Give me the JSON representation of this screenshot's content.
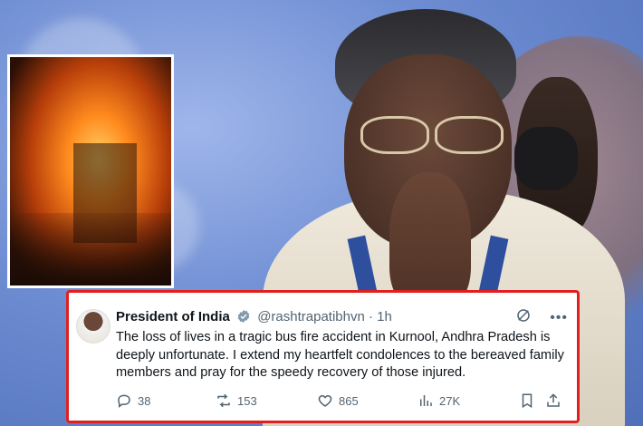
{
  "scene": {
    "inset_photo": "bus-fire-photo",
    "main_photo": "president-namaste-photo"
  },
  "tweet": {
    "author_name": "President of India",
    "handle_time": "@rashtrapatibhvn · 1h",
    "text": "The loss of lives in a tragic bus fire accident in Kurnool, Andhra Pradesh is deeply unfortunate. I extend my heartfelt condolences to the bereaved family members and pray for the speedy recovery of those injured.",
    "actions": {
      "replies": "38",
      "retweets": "153",
      "likes": "865",
      "views": "27K"
    },
    "colors": {
      "border": "#e02020",
      "verified": "#829aab",
      "text": "#0f1419",
      "muted": "#536471"
    },
    "icons": [
      "verified-badge-icon",
      "grok-icon",
      "more-icon",
      "reply-icon",
      "retweet-icon",
      "like-icon",
      "views-icon",
      "bookmark-icon",
      "share-icon"
    ]
  }
}
